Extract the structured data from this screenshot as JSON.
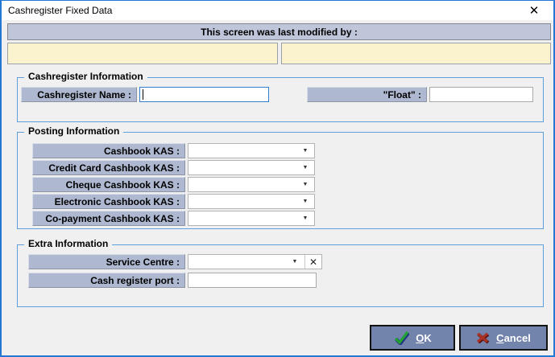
{
  "window": {
    "title": "Cashregister Fixed Data",
    "close_glyph": "✕"
  },
  "header": {
    "modified_by_label": "This screen was last modified by :",
    "modified_by_value_1": "",
    "modified_by_value_2": ""
  },
  "sections": {
    "cashregister_info": {
      "title": "Cashregister Information",
      "fields": [
        {
          "label": "Cashregister Name :",
          "value": "",
          "type": "text",
          "focused": true
        },
        {
          "label": "\"Float\" :",
          "value": "",
          "type": "text"
        }
      ]
    },
    "posting_info": {
      "title": "Posting Information",
      "fields": [
        {
          "label": "Cashbook KAS :",
          "value": "",
          "type": "dropdown"
        },
        {
          "label": "Credit Card Cashbook KAS :",
          "value": "",
          "type": "dropdown"
        },
        {
          "label": "Cheque Cashbook KAS :",
          "value": "",
          "type": "dropdown"
        },
        {
          "label": "Electronic Cashbook KAS :",
          "value": "",
          "type": "dropdown"
        },
        {
          "label": "Co-payment Cashbook KAS :",
          "value": "",
          "type": "dropdown"
        }
      ]
    },
    "extra_info": {
      "title": "Extra Information",
      "fields": [
        {
          "label": "Service Centre :",
          "value": "",
          "type": "dropdown-clearable"
        },
        {
          "label": "Cash register port :",
          "value": "",
          "type": "text"
        }
      ]
    }
  },
  "icons": {
    "dropdown_arrow": "▼",
    "clear_x": "✕",
    "ok_check": "green-check-icon",
    "cancel_x": "red-x-icon"
  },
  "buttons": {
    "ok_mnemonic": "O",
    "ok_rest": "K",
    "cancel_mnemonic": "C",
    "cancel_rest": "ancel"
  },
  "colors": {
    "window_border": "#2577D4",
    "dialog_bg": "#F0F0F0",
    "header_bar_bg": "#BFC6DA",
    "note_box_bg": "#FBF3CE",
    "field_label_bg": "#AEB8D0",
    "group_border": "#5F9FDE",
    "focus_border": "#2F80D0",
    "button_bg": "#7283AC",
    "ok_check_green": "#1FA332",
    "cancel_x_red": "#A93226"
  }
}
